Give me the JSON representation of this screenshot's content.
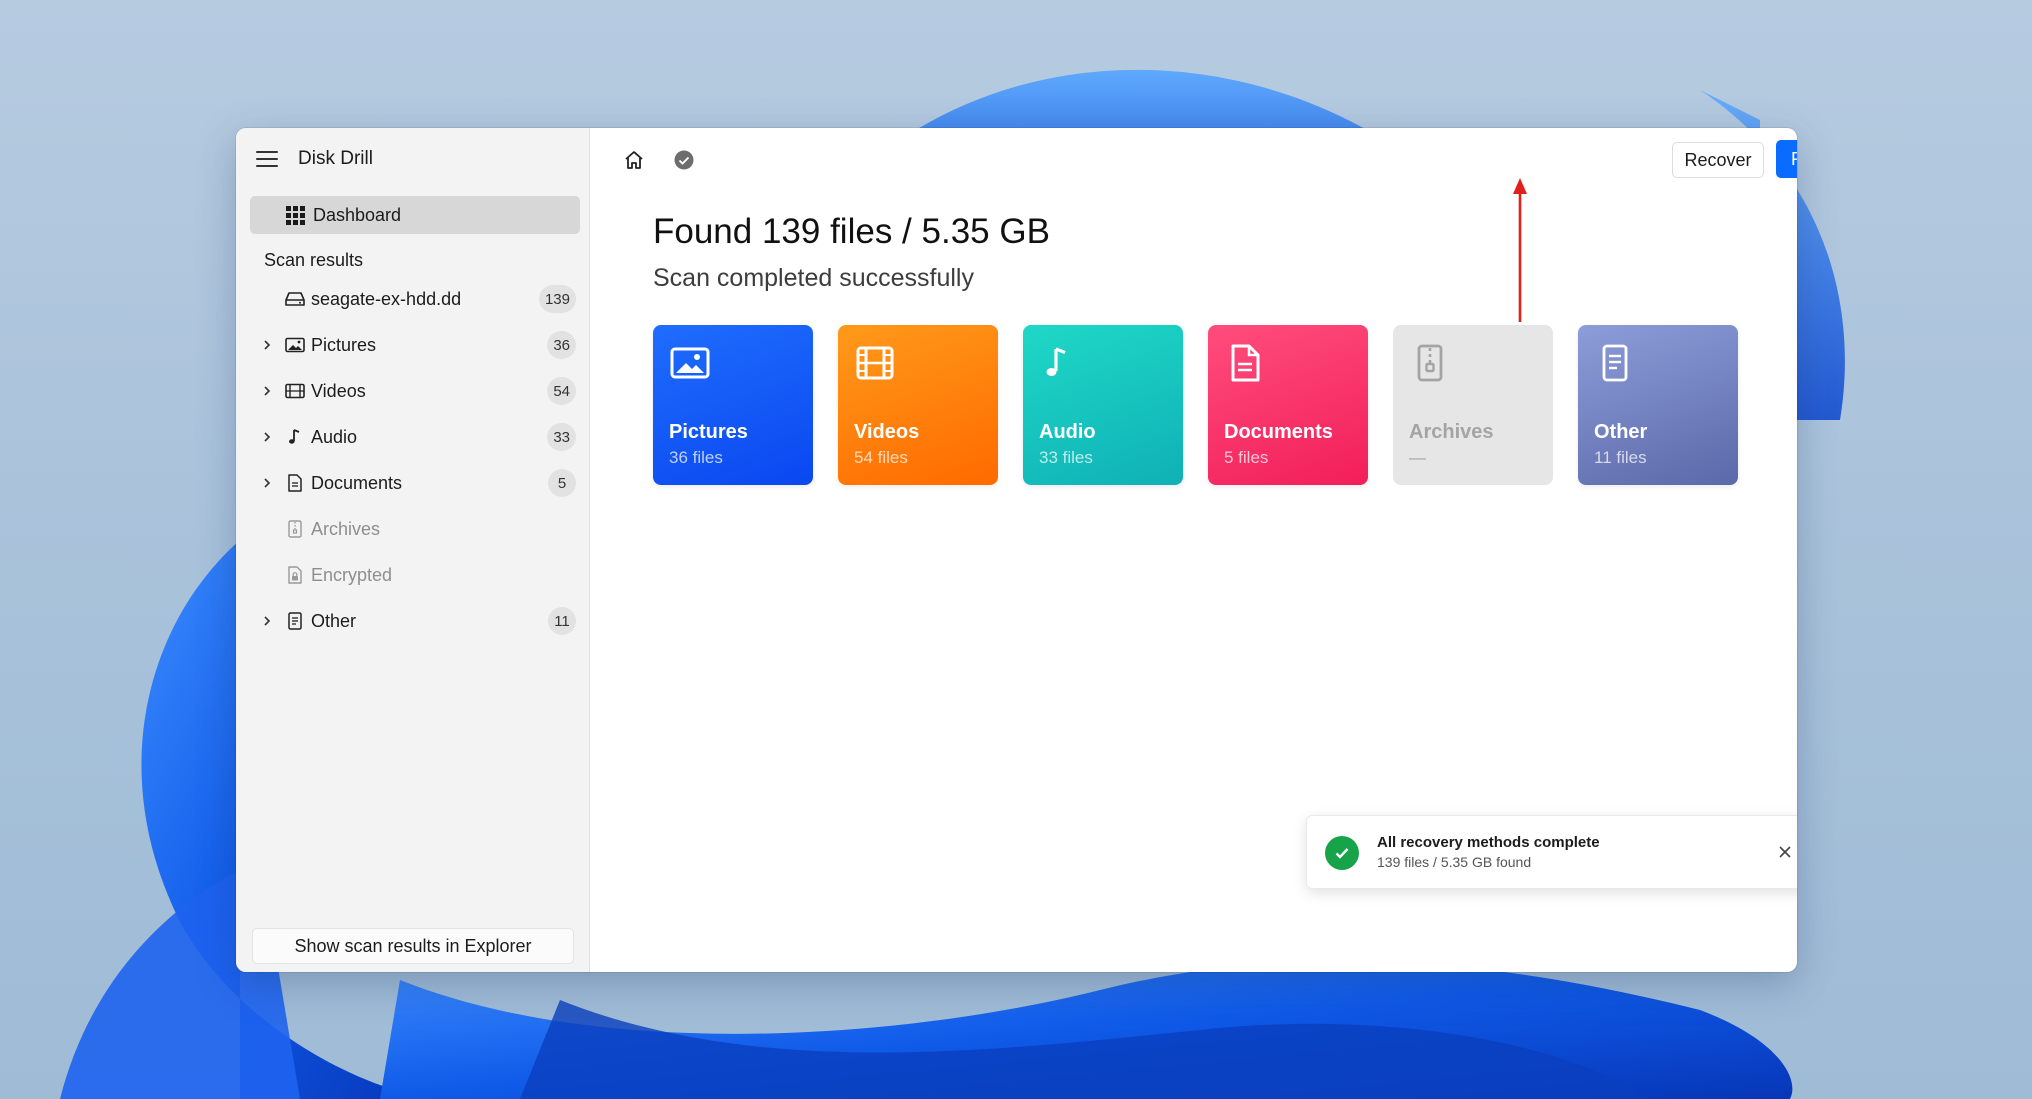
{
  "app": {
    "title": "Disk Drill"
  },
  "sidebar": {
    "dashboard_label": "Dashboard",
    "section_label": "Scan results",
    "items": [
      {
        "label": "seagate-ex-hdd.dd",
        "count": "139",
        "icon": "drive-icon",
        "expandable": false,
        "disabled": false
      },
      {
        "label": "Pictures",
        "count": "36",
        "icon": "picture-icon",
        "expandable": true,
        "disabled": false
      },
      {
        "label": "Videos",
        "count": "54",
        "icon": "film-icon",
        "expandable": true,
        "disabled": false
      },
      {
        "label": "Audio",
        "count": "33",
        "icon": "music-note-icon",
        "expandable": true,
        "disabled": false
      },
      {
        "label": "Documents",
        "count": "5",
        "icon": "document-icon",
        "expandable": true,
        "disabled": false
      },
      {
        "label": "Archives",
        "count": "",
        "icon": "archive-icon",
        "expandable": false,
        "disabled": true
      },
      {
        "label": "Encrypted",
        "count": "",
        "icon": "encrypted-file-icon",
        "expandable": false,
        "disabled": true
      },
      {
        "label": "Other",
        "count": "11",
        "icon": "other-file-icon",
        "expandable": true,
        "disabled": false
      }
    ],
    "explorer_button": "Show scan results in Explorer"
  },
  "toolbar": {
    "recover_label": "Recover",
    "review_label": "Review found items"
  },
  "main": {
    "heading": "Found 139 files / 5.35 GB",
    "subheading": "Scan completed successfully",
    "cards": [
      {
        "title": "Pictures",
        "sub": "36 files",
        "icon": "picture-icon",
        "key": "pictures"
      },
      {
        "title": "Videos",
        "sub": "54 files",
        "icon": "film-icon",
        "key": "videos"
      },
      {
        "title": "Audio",
        "sub": "33 files",
        "icon": "music-note-icon",
        "key": "audio"
      },
      {
        "title": "Documents",
        "sub": "5 files",
        "icon": "document-icon",
        "key": "documents"
      },
      {
        "title": "Archives",
        "sub": "—",
        "icon": "archive-icon",
        "key": "archives"
      },
      {
        "title": "Other",
        "sub": "11 files",
        "icon": "other-file-icon",
        "key": "other"
      }
    ]
  },
  "toast": {
    "title": "All recovery methods complete",
    "subtitle": "139 files / 5.35 GB found"
  },
  "colors": {
    "accent": "#0a6cff",
    "annotation_arrow": "#e0201b",
    "success": "#17a34a"
  }
}
